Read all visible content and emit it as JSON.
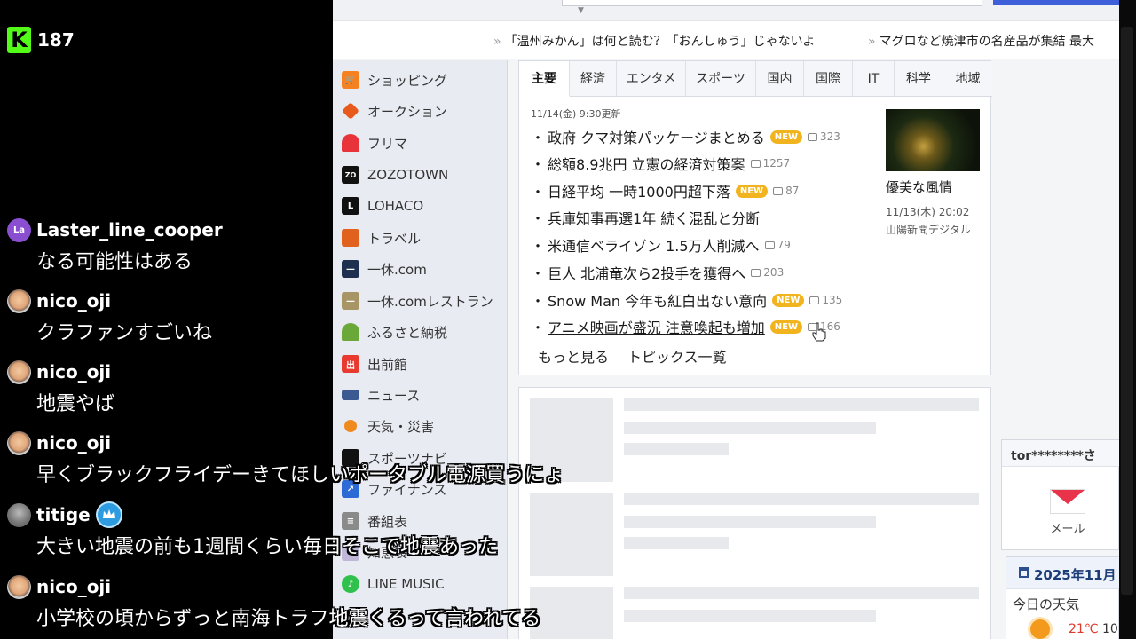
{
  "stream": {
    "viewer_count": "187",
    "logo_letter": "K",
    "chat": [
      {
        "user": "Laster_line_cooper",
        "avatar_text": "La",
        "message": "なる可能性はある"
      },
      {
        "user": "nico_oji",
        "message": "クラファンすごいね"
      },
      {
        "user": "nico_oji",
        "message": "地震やば"
      },
      {
        "user": "nico_oji",
        "message": "早くブラックフライデーきてほしいポータブル電源買うにょ"
      },
      {
        "user": "titige",
        "message": "大きい地震の前も1週間くらい毎日そこで地震あった"
      },
      {
        "user": "nico_oji",
        "message": "小学校の頃からずっと南海トラフ地震くるって言われてる"
      }
    ]
  },
  "ticker": {
    "item1": "「温州みかん」は何と読む？「おんしゅう」じゃないよ",
    "item2": "マグロなど焼津市の名産品が集結 最大"
  },
  "services": [
    {
      "label": "ショッピング",
      "icon": "cart-icon"
    },
    {
      "label": "オークション",
      "icon": "auction-hammer-icon"
    },
    {
      "label": "フリマ",
      "icon": "flea-market-icon"
    },
    {
      "label": "ZOZOTOWN",
      "icon": "zozo-icon"
    },
    {
      "label": "LOHACO",
      "icon": "lohaco-icon"
    },
    {
      "label": "トラベル",
      "icon": "suitcase-icon"
    },
    {
      "label": "一休.com",
      "icon": "ikyu-icon"
    },
    {
      "label": "一休.comレストラン",
      "icon": "ikyu-restaurant-icon"
    },
    {
      "label": "ふるさと納税",
      "icon": "furusato-icon"
    },
    {
      "label": "出前館",
      "icon": "demaekan-icon"
    },
    {
      "label": "ニュース",
      "icon": "news-icon"
    },
    {
      "label": "天気・災害",
      "icon": "weather-icon"
    },
    {
      "label": "スポーツナビ",
      "icon": "sports-icon"
    },
    {
      "label": "ファイナンス",
      "icon": "finance-chart-icon"
    },
    {
      "label": "番組表",
      "icon": "tv-guide-icon"
    },
    {
      "label": "知恵袋",
      "icon": "chiebukuro-icon"
    },
    {
      "label": "LINE MUSIC",
      "icon": "line-music-icon"
    }
  ],
  "news": {
    "tabs": [
      "主要",
      "経済",
      "エンタメ",
      "スポーツ",
      "国内",
      "国際",
      "IT",
      "科学",
      "地域"
    ],
    "active_tab": "主要",
    "updated": "11/14(金) 9:30更新",
    "new_label": "NEW",
    "headlines": [
      {
        "text": "政府 クマ対策パッケージまとめる",
        "new": true,
        "comments": "323"
      },
      {
        "text": "総額8.9兆円 立憲の経済対策案",
        "new": false,
        "comments": "1257"
      },
      {
        "text": "日経平均 一時1000円超下落",
        "new": true,
        "comments": "87"
      },
      {
        "text": "兵庫知事再選1年 続く混乱と分断",
        "new": false,
        "comments": ""
      },
      {
        "text": "米通信ベライゾン 1.5万人削減へ",
        "new": false,
        "comments": "79"
      },
      {
        "text": "巨人 北浦竜次ら2投手を獲得へ",
        "new": false,
        "comments": "203"
      },
      {
        "text": "Snow Man 今年も紅白出ない意向",
        "new": true,
        "comments": "135"
      },
      {
        "text": "アニメ映画が盛況 注意喚起も増加",
        "new": true,
        "comments": "166"
      }
    ],
    "more": "もっと見る",
    "topics": "トピックス一覧",
    "pickup": {
      "title": "優美な風情",
      "date": "11/13(木) 20:02",
      "source": "山陽新聞デジタル"
    }
  },
  "account": {
    "name": "tor********さ",
    "mail_label": "メール"
  },
  "weather": {
    "date": "2025年11月",
    "today": "今日の天気",
    "high": "21℃",
    "low": "10"
  },
  "colors": {
    "kick_green": "#53fc18",
    "new_badge": "#f2b41e",
    "mail_red": "#e8334a",
    "weather_high": "#e0392c"
  }
}
